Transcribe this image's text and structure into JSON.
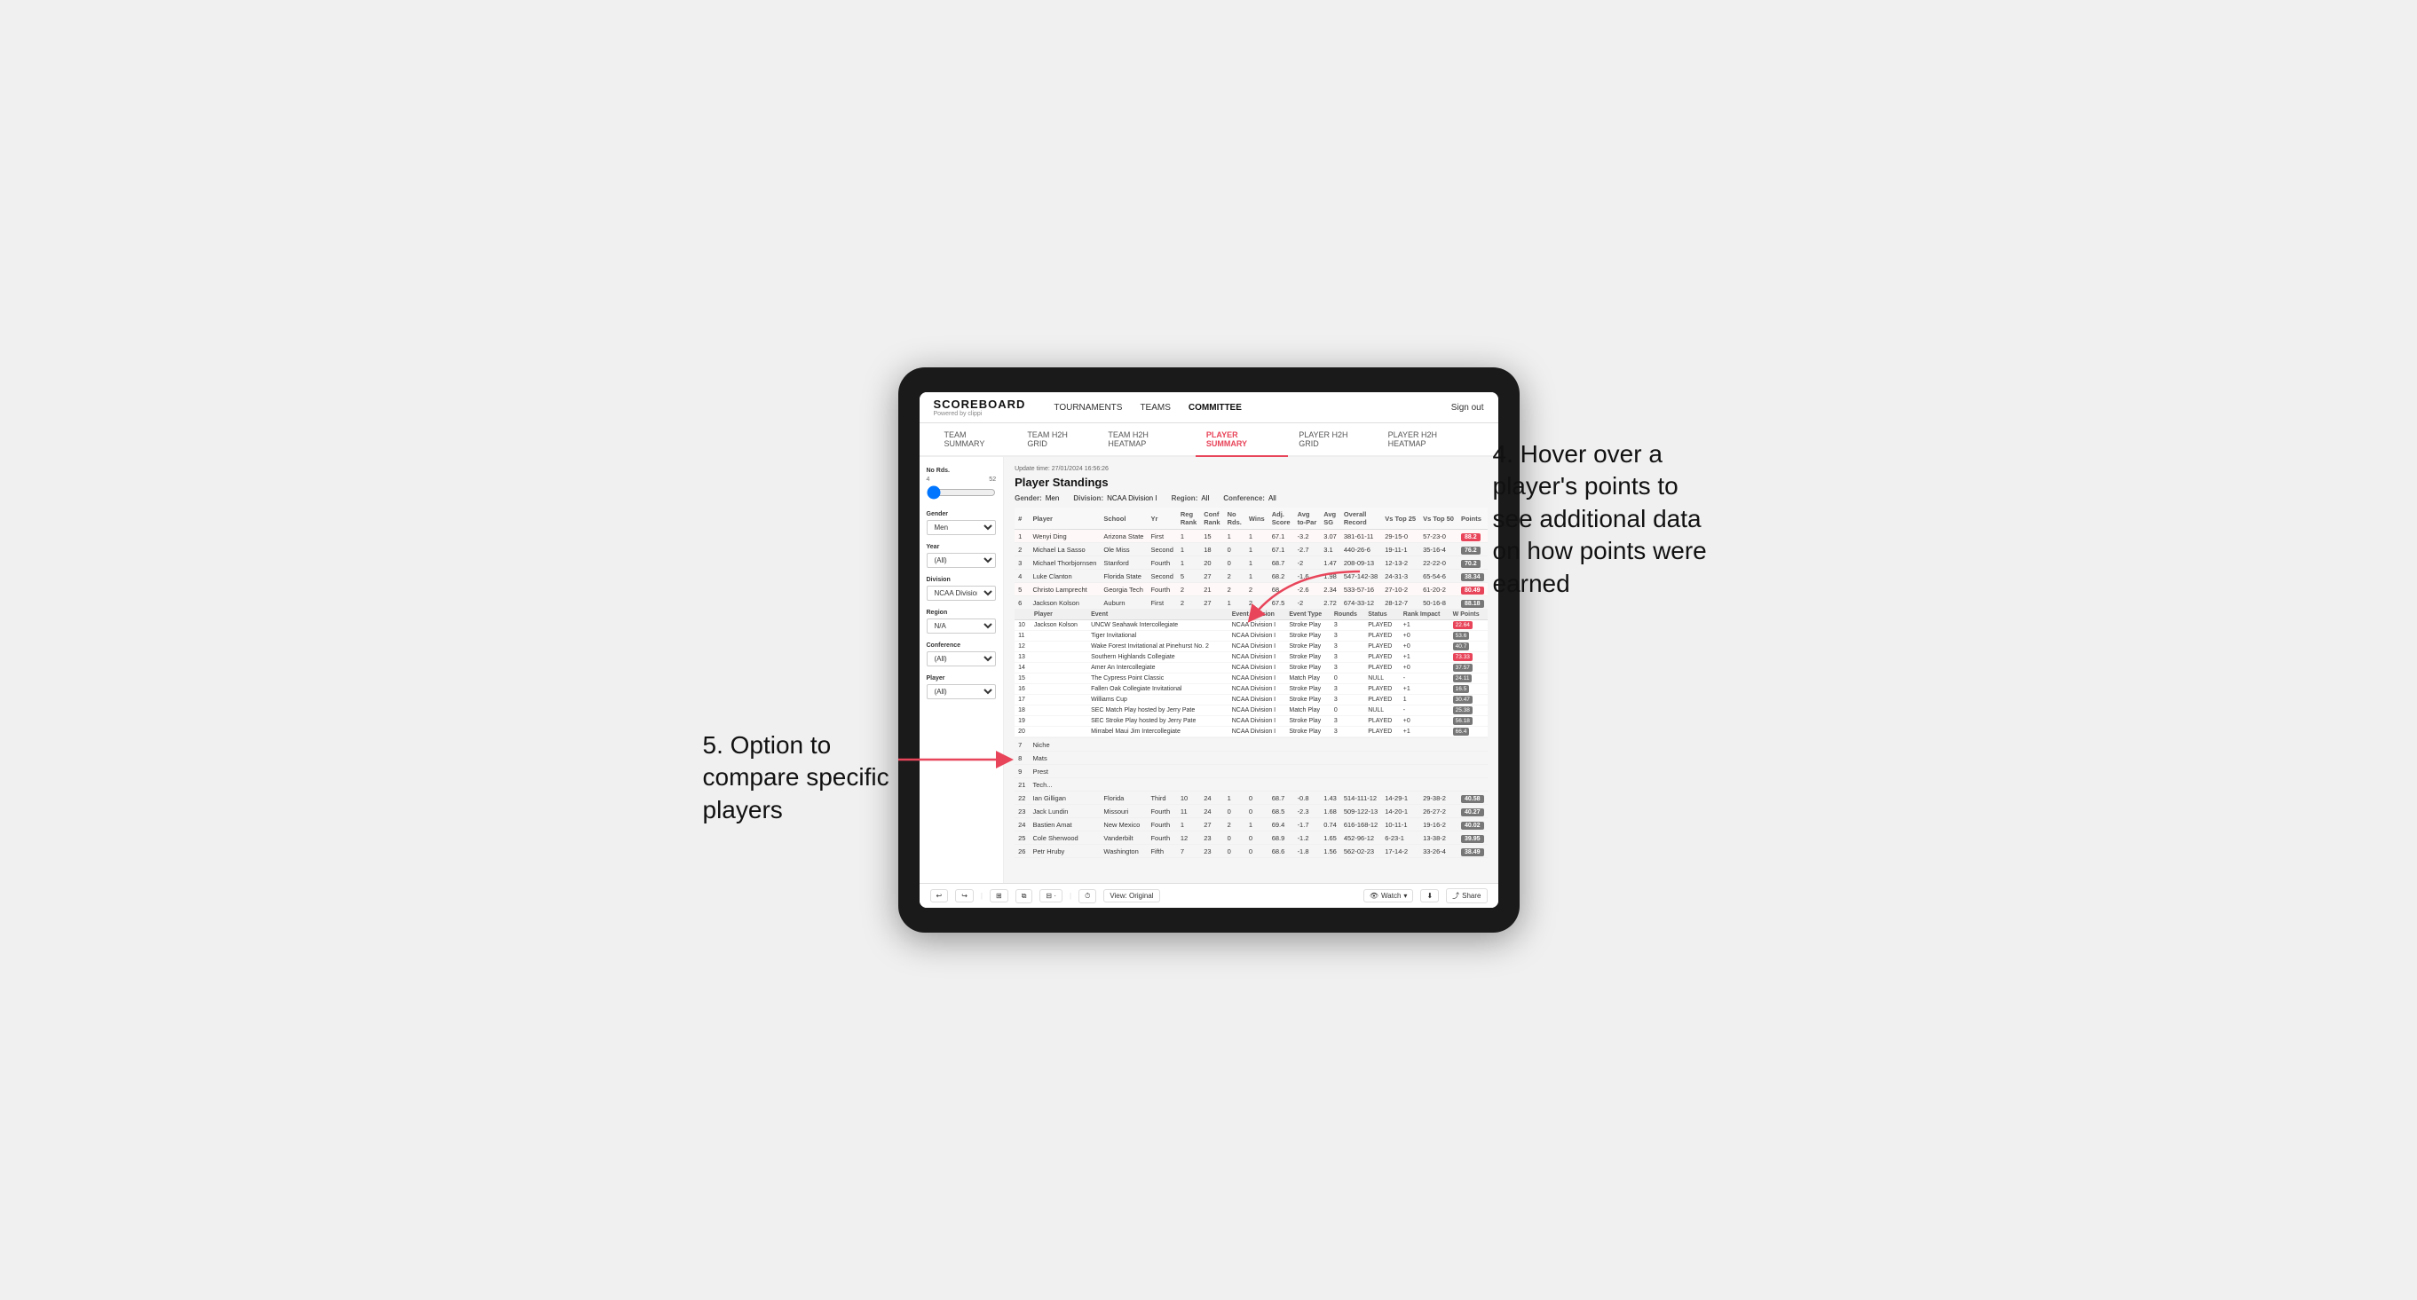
{
  "annotations": {
    "top_right": "4. Hover over a player's points to see additional data on how points were earned",
    "bottom_left": "5. Option to compare specific players"
  },
  "nav": {
    "logo": "SCOREBOARD",
    "logo_sub": "Powered by clippi",
    "links": [
      "TOURNAMENTS",
      "TEAMS",
      "COMMITTEE"
    ],
    "sign_out": "Sign out"
  },
  "sub_nav": {
    "items": [
      "TEAM SUMMARY",
      "TEAM H2H GRID",
      "TEAM H2H HEATMAP",
      "PLAYER SUMMARY",
      "PLAYER H2H GRID",
      "PLAYER H2H HEATMAP"
    ],
    "active": "PLAYER SUMMARY"
  },
  "sidebar": {
    "no_rds_label": "No Rds.",
    "no_rds_min": "4",
    "no_rds_max": "52",
    "gender_label": "Gender",
    "gender_value": "Men",
    "year_label": "Year",
    "year_value": "(All)",
    "division_label": "Division",
    "division_value": "NCAA Division I",
    "region_label": "Region",
    "region_value": "N/A",
    "conference_label": "Conference",
    "conference_value": "(All)",
    "player_label": "Player",
    "player_value": "(All)"
  },
  "content": {
    "update_time": "Update time: 27/01/2024 16:56:26",
    "title": "Player Standings",
    "filters": {
      "gender": "Men",
      "division": "NCAA Division I",
      "region": "All",
      "conference": "All"
    },
    "table_headers": [
      "#",
      "Player",
      "School",
      "Yr",
      "Reg Rank",
      "Conf Rank",
      "No Rds.",
      "Wins",
      "Adj. Score",
      "Avg to-Par",
      "Avg SG",
      "Overall Record",
      "Vs Top 25",
      "Vs Top 50",
      "Points"
    ],
    "players": [
      {
        "rank": 1,
        "name": "Wenyi Ding",
        "school": "Arizona State",
        "yr": "First",
        "reg_rank": 1,
        "conf_rank": 15,
        "no_rds": 1,
        "wins": 1,
        "adj_score": 67.1,
        "avg_par": -3.2,
        "avg_sg": 3.07,
        "overall": "381-61-11",
        "vs_top25": "29-15-0",
        "vs_top50": "57-23-0",
        "points": 88.2,
        "highlight": true
      },
      {
        "rank": 2,
        "name": "Michael La Sasso",
        "school": "Ole Miss",
        "yr": "Second",
        "reg_rank": 1,
        "conf_rank": 18,
        "no_rds": 0,
        "wins": 1,
        "adj_score": 67.1,
        "avg_par": -2.7,
        "avg_sg": 3.1,
        "overall": "440-26-6",
        "vs_top25": "19-11-1",
        "vs_top50": "35-16-4",
        "points": 76.2
      },
      {
        "rank": 3,
        "name": "Michael Thorbjornsen",
        "school": "Stanford",
        "yr": "Fourth",
        "reg_rank": 1,
        "conf_rank": 20,
        "no_rds": 0,
        "wins": 1,
        "adj_score": 68.7,
        "avg_par": -2.0,
        "avg_sg": 1.47,
        "overall": "208-09-13",
        "vs_top25": "12-13-2",
        "vs_top50": "22-22-0",
        "points": 70.2
      },
      {
        "rank": 4,
        "name": "Luke Clanton",
        "school": "Florida State",
        "yr": "Second",
        "reg_rank": 5,
        "conf_rank": 27,
        "no_rds": 2,
        "wins": 1,
        "adj_score": 68.2,
        "avg_par": -1.6,
        "avg_sg": 1.98,
        "overall": "547-142-38",
        "vs_top25": "24-31-3",
        "vs_top50": "65-54-6",
        "points": 38.34
      },
      {
        "rank": 5,
        "name": "Christo Lamprecht",
        "school": "Georgia Tech",
        "yr": "Fourth",
        "reg_rank": 2,
        "conf_rank": 21,
        "no_rds": 2,
        "wins": 2,
        "adj_score": 68.0,
        "avg_par": -2.6,
        "avg_sg": 2.34,
        "overall": "533-57-16",
        "vs_top25": "27-10-2",
        "vs_top50": "61-20-2",
        "points": 80.49,
        "highlight": true
      },
      {
        "rank": 6,
        "name": "Jackson Kolson",
        "school": "Auburn",
        "yr": "First",
        "reg_rank": 2,
        "conf_rank": 27,
        "no_rds": 1,
        "wins": 2,
        "adj_score": 67.5,
        "avg_par": -2.0,
        "avg_sg": 2.72,
        "overall": "674-33-12",
        "vs_top25": "28-12-7",
        "vs_top50": "50-16-8",
        "points": 88.18
      },
      {
        "rank": 7,
        "name": "Niche",
        "school": "",
        "yr": "",
        "reg_rank": null,
        "conf_rank": null,
        "no_rds": null,
        "wins": null,
        "adj_score": null,
        "avg_par": null,
        "avg_sg": null,
        "overall": "",
        "vs_top25": "",
        "vs_top50": "",
        "points": null,
        "divider": true
      },
      {
        "rank": 8,
        "name": "Mats",
        "school": "",
        "yr": "",
        "reg_rank": null,
        "conf_rank": null,
        "no_rds": null,
        "wins": null,
        "adj_score": null,
        "avg_par": null,
        "avg_sg": null,
        "overall": "",
        "vs_top25": "",
        "vs_top50": "",
        "points": null
      },
      {
        "rank": 9,
        "name": "Prest",
        "school": "",
        "yr": "",
        "reg_rank": null,
        "conf_rank": null,
        "no_rds": null,
        "wins": null,
        "adj_score": null,
        "avg_par": null,
        "avg_sg": null,
        "overall": "",
        "vs_top25": "",
        "vs_top50": "",
        "points": null
      }
    ],
    "expanded_player": "Jackson Kolson",
    "expanded_events": [
      {
        "event": "UNCW Seahawk Intercollegiate",
        "division": "NCAA Division I",
        "type": "Stroke Play",
        "rounds": 3,
        "status": "PLAYED",
        "rank_impact": "+1",
        "w_points": 22.64,
        "highlight": true
      },
      {
        "event": "Tiger Invitational",
        "division": "NCAA Division I",
        "type": "Stroke Play",
        "rounds": 3,
        "status": "PLAYED",
        "rank_impact": "+0",
        "w_points": 53.6
      },
      {
        "event": "Wake Forest Invitational at Pinehurst No. 2",
        "division": "NCAA Division I",
        "type": "Stroke Play",
        "rounds": 3,
        "status": "PLAYED",
        "rank_impact": "+0",
        "w_points": 40.7
      },
      {
        "event": "Southern Highlands Collegiate",
        "division": "NCAA Division I",
        "type": "Stroke Play",
        "rounds": 3,
        "status": "PLAYED",
        "rank_impact": "+1",
        "w_points": 73.33,
        "highlight": true
      },
      {
        "event": "Amer An Intercollegiate",
        "division": "NCAA Division I",
        "type": "Stroke Play",
        "rounds": 3,
        "status": "PLAYED",
        "rank_impact": "+0",
        "w_points": 37.57
      },
      {
        "event": "The Cypress Point Classic",
        "division": "NCAA Division I",
        "type": "Match Play",
        "rounds": 0,
        "status": "NULL",
        "rank_impact": "-",
        "w_points": 24.11
      },
      {
        "event": "Fallen Oak Collegiate Invitational",
        "division": "NCAA Division I",
        "type": "Stroke Play",
        "rounds": 3,
        "status": "PLAYED",
        "rank_impact": "+1",
        "w_points": 16.5
      },
      {
        "event": "Williams Cup",
        "division": "NCAA Division I",
        "type": "Stroke Play",
        "rounds": 3,
        "status": "PLAYED",
        "rank_impact": "1",
        "w_points": 30.47
      },
      {
        "event": "SEC Match Play hosted by Jerry Pate",
        "division": "NCAA Division I",
        "type": "Match Play",
        "rounds": 0,
        "status": "NULL",
        "rank_impact": "-",
        "w_points": 25.38
      },
      {
        "event": "SEC Stroke Play hosted by Jerry Pate",
        "division": "NCAA Division I",
        "type": "Stroke Play",
        "rounds": 3,
        "status": "PLAYED",
        "rank_impact": "+0",
        "w_points": 56.18
      },
      {
        "event": "Mirrabel Maui Jim Intercollegiate",
        "division": "NCAA Division I",
        "type": "Stroke Play",
        "rounds": 3,
        "status": "PLAYED",
        "rank_impact": "+1",
        "w_points": 66.4
      }
    ],
    "more_players": [
      {
        "rank": 21,
        "name": "Tech...",
        "school": "",
        "yr": "",
        "reg_rank": null,
        "conf_rank": null,
        "no_rds": null,
        "wins": null,
        "adj_score": null,
        "avg_par": null,
        "avg_sg": null,
        "overall": "",
        "vs_top25": "",
        "vs_top50": "",
        "points": null
      },
      {
        "rank": 22,
        "name": "Ian Gilligan",
        "school": "Florida",
        "yr": "Third",
        "reg_rank": 10,
        "conf_rank": 24,
        "no_rds": 1,
        "wins": 0,
        "adj_score": 68.7,
        "avg_par": -0.8,
        "avg_sg": 1.43,
        "overall": "514-111-12",
        "vs_top25": "14-29-1",
        "vs_top50": "29-38-2",
        "points": 40.58
      },
      {
        "rank": 23,
        "name": "Jack Lundin",
        "school": "Missouri",
        "yr": "Fourth",
        "reg_rank": 11,
        "conf_rank": 24,
        "no_rds": 0,
        "wins": 0,
        "adj_score": 68.5,
        "avg_par": -2.3,
        "avg_sg": 1.68,
        "overall": "509-122-13",
        "vs_top25": "14-20-1",
        "vs_top50": "26-27-2",
        "points": 40.27
      },
      {
        "rank": 24,
        "name": "Bastien Amat",
        "school": "New Mexico",
        "yr": "Fourth",
        "reg_rank": 1,
        "conf_rank": 27,
        "no_rds": 2,
        "wins": 1,
        "adj_score": 69.4,
        "avg_par": -1.7,
        "avg_sg": 0.74,
        "overall": "616-168-12",
        "vs_top25": "10-11-1",
        "vs_top50": "19-16-2",
        "points": 40.02
      },
      {
        "rank": 25,
        "name": "Cole Sherwood",
        "school": "Vanderbilt",
        "yr": "Fourth",
        "reg_rank": 12,
        "conf_rank": 23,
        "no_rds": 0,
        "wins": 0,
        "adj_score": 68.9,
        "avg_par": -1.2,
        "avg_sg": 1.65,
        "overall": "452-96-12",
        "vs_top25": "6-23-1",
        "vs_top50": "13-38-2",
        "points": 39.95
      },
      {
        "rank": 26,
        "name": "Petr Hruby",
        "school": "Washington",
        "yr": "Fifth",
        "reg_rank": 7,
        "conf_rank": 23,
        "no_rds": 0,
        "wins": 0,
        "adj_score": 68.6,
        "avg_par": -1.8,
        "avg_sg": 1.56,
        "overall": "562-02-23",
        "vs_top25": "17-14-2",
        "vs_top50": "33-26-4",
        "points": 38.49
      }
    ]
  },
  "toolbar": {
    "view_label": "View: Original",
    "watch_label": "Watch",
    "share_label": "Share"
  }
}
